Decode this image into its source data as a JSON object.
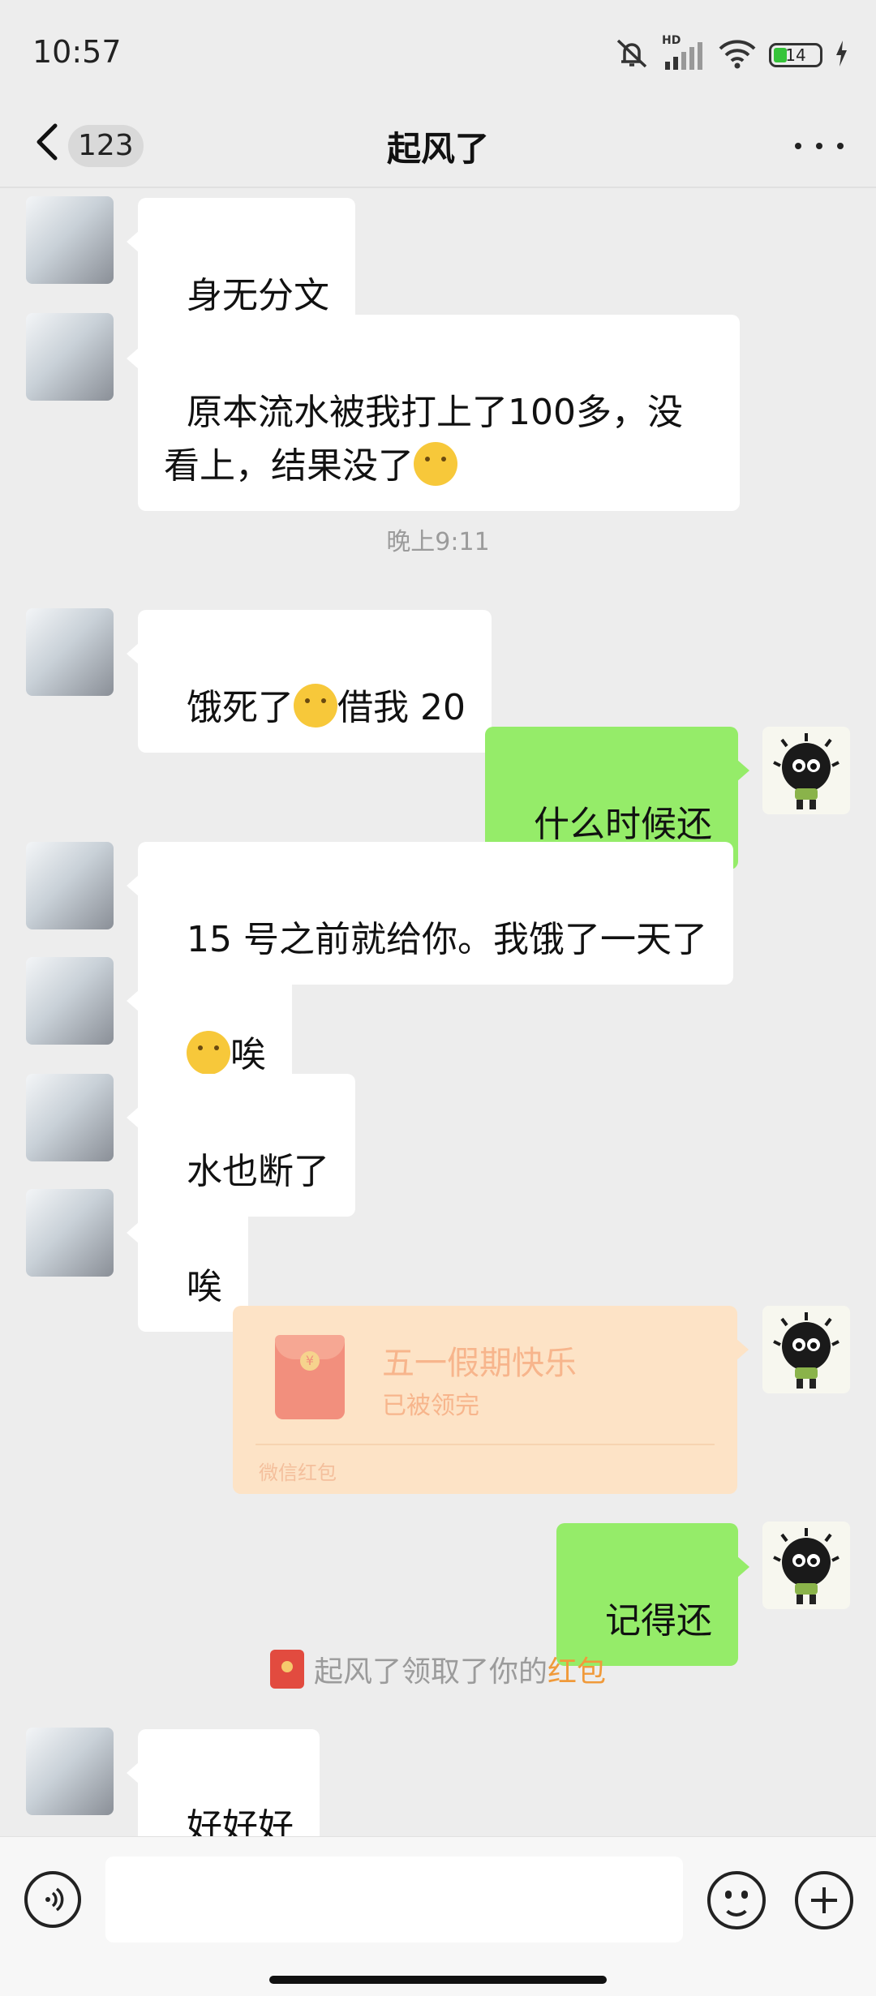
{
  "status": {
    "time": "10:57",
    "hd_label": "HD",
    "battery_level": "14"
  },
  "nav": {
    "badge": "123",
    "title": "起风了"
  },
  "messages": [
    {
      "side": "in",
      "text": "身无分文"
    },
    {
      "side": "in",
      "text": "原本流水被我打上了100多，没看上，结果没了",
      "emoji": "face-with-tears-of-joy"
    },
    {
      "side": "in",
      "text_a": "饿死了",
      "emoji": "face-with-tears-of-joy",
      "text_b": "借我 20"
    },
    {
      "side": "out",
      "text": "什么时候还"
    },
    {
      "side": "in",
      "text": "15 号之前就给你。我饿了一天了"
    },
    {
      "side": "in",
      "emoji": "crying-face",
      "text": "唉"
    },
    {
      "side": "in",
      "text": "水也断了"
    },
    {
      "side": "in",
      "text": "唉"
    },
    {
      "side": "out",
      "text": "记得还"
    },
    {
      "side": "in",
      "text": "好好好"
    }
  ],
  "timestamp": "晚上9:11",
  "red_packet": {
    "title": "五一假期快乐",
    "status": "已被领完",
    "footer": "微信红包"
  },
  "system_note": {
    "prefix": "起风了领取了你的",
    "link": "红包"
  },
  "colors": {
    "background": "#ededed",
    "out_bubble": "#95ec69",
    "in_bubble": "#ffffff",
    "red_packet": "#fde3c6",
    "link_orange": "#f09a3a"
  }
}
